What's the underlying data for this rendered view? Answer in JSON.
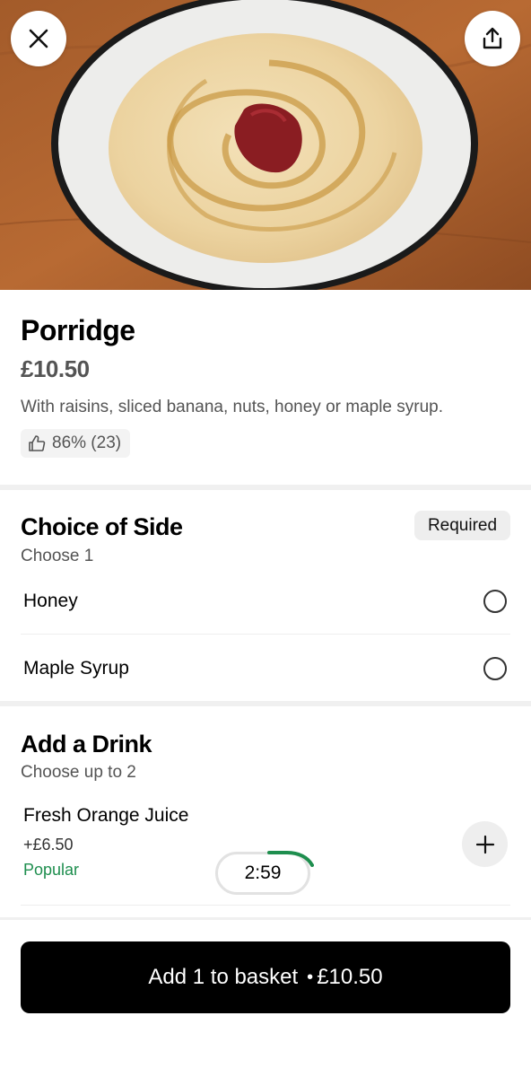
{
  "item": {
    "title": "Porridge",
    "price": "£10.50",
    "description": "With raisins, sliced banana, nuts, honey or maple syrup.",
    "rating": "86% (23)"
  },
  "side_section": {
    "title": "Choice of Side",
    "subtitle": "Choose 1",
    "badge": "Required",
    "options": [
      {
        "label": "Honey"
      },
      {
        "label": "Maple Syrup"
      }
    ]
  },
  "drink_section": {
    "title": "Add a Drink",
    "subtitle": "Choose up to 2",
    "items": [
      {
        "name": "Fresh Orange Juice",
        "price": "+£6.50",
        "badge": "Popular"
      }
    ]
  },
  "timer": {
    "value": "2:59",
    "remaining_fraction": 0.25
  },
  "basket": {
    "label": "Add 1 to basket",
    "separator": "•",
    "total": "£10.50"
  },
  "icons": {
    "close": "close-icon",
    "share": "share-icon",
    "thumb": "thumbs-up-icon",
    "plus": "plus-icon"
  },
  "colors": {
    "accent_green": "#1e8e4e",
    "button_black": "#000000"
  }
}
